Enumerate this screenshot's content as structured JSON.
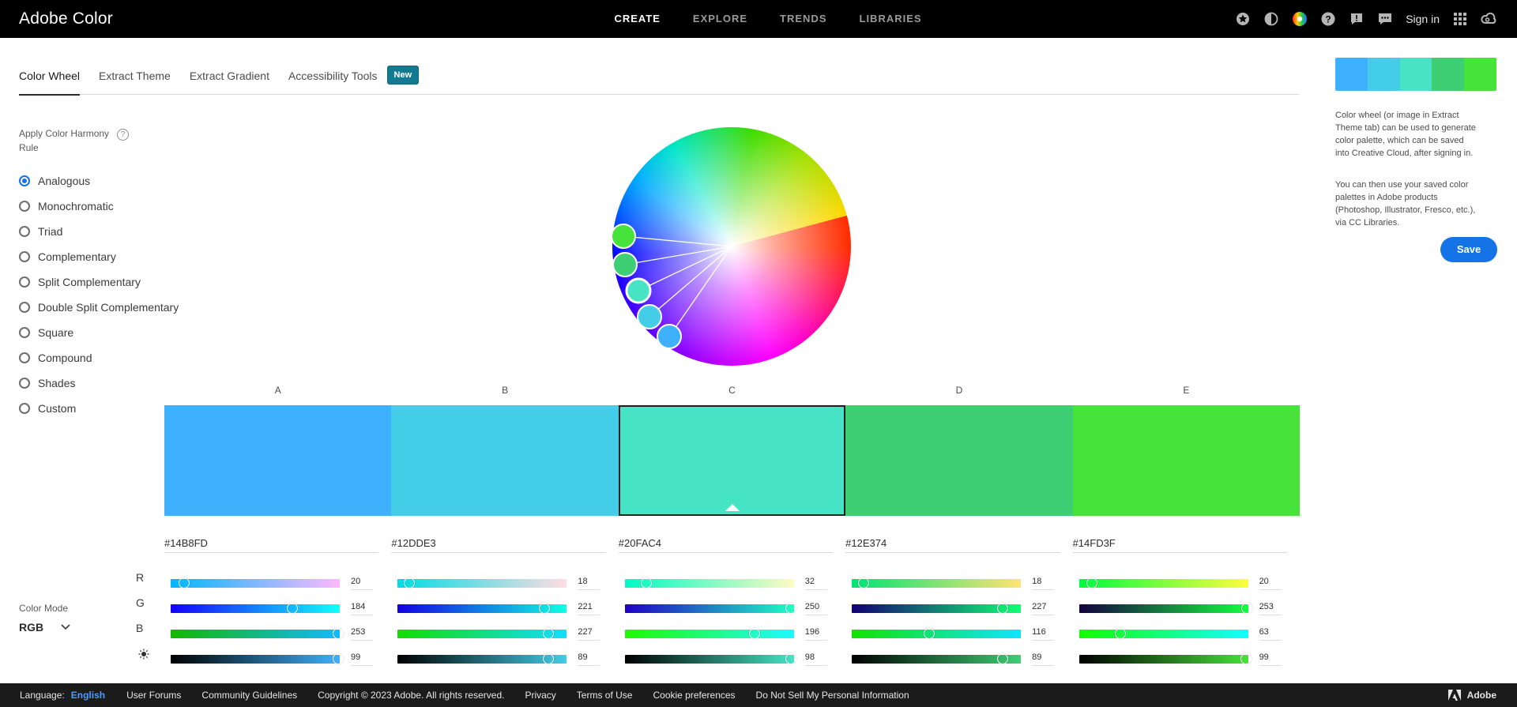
{
  "app": {
    "brand": "Adobe Color"
  },
  "topnav": {
    "items": [
      "CREATE",
      "EXPLORE",
      "TRENDS",
      "LIBRARIES"
    ],
    "active": "CREATE",
    "sign_in": "Sign in",
    "icons": [
      "favorites-icon",
      "contrast-icon",
      "color-wheel-icon",
      "help-icon",
      "feedback-icon",
      "chat-icon",
      "apps-grid-icon",
      "creative-cloud-icon"
    ]
  },
  "tabs": {
    "items": [
      "Color Wheel",
      "Extract Theme",
      "Extract Gradient",
      "Accessibility Tools"
    ],
    "active": "Color Wheel",
    "badge": "New"
  },
  "harmony": {
    "title": "Apply Color Harmony Rule",
    "help": "?",
    "options": [
      "Analogous",
      "Monochromatic",
      "Triad",
      "Complementary",
      "Split Complementary",
      "Double Split Complementary",
      "Square",
      "Compound",
      "Shades",
      "Custom"
    ],
    "selected": "Analogous"
  },
  "color_mode": {
    "label": "Color Mode",
    "value": "RGB"
  },
  "swatches": [
    {
      "label": "A",
      "hex": "#14B8FD",
      "color": "#3fb0fb",
      "r": 20,
      "g": 184,
      "b": 253,
      "brightness": 99
    },
    {
      "label": "B",
      "hex": "#12DDE3",
      "color": "#43cde6",
      "r": 18,
      "g": 221,
      "b": 227,
      "brightness": 89
    },
    {
      "label": "C",
      "hex": "#20FAC4",
      "color": "#46e4c4",
      "r": 32,
      "g": 250,
      "b": 196,
      "brightness": 98
    },
    {
      "label": "D",
      "hex": "#12E374",
      "color": "#3ece74",
      "r": 18,
      "g": 227,
      "b": 116,
      "brightness": 89
    },
    {
      "label": "E",
      "hex": "#14FD3F",
      "color": "#47e23a",
      "r": 20,
      "g": 253,
      "b": 63,
      "brightness": 99
    }
  ],
  "active_swatch": "C",
  "slider_labels": {
    "r": "R",
    "g": "G",
    "b": "B",
    "brightness": "brightness-icon"
  },
  "right_panel": {
    "text1": "Color wheel (or image in Extract Theme tab) can be used to generate color palette, which can be saved into Creative Cloud, after signing in.",
    "text2": "You can then use your saved color palettes in Adobe products (Photoshop, Illustrator, Fresco, etc.), via CC Libraries.",
    "save": "Save"
  },
  "footer": {
    "language_label": "Language:",
    "language": "English",
    "links": [
      "User Forums",
      "Community Guidelines",
      "Copyright © 2023 Adobe. All rights reserved.",
      "Privacy",
      "Terms of Use",
      "Cookie preferences",
      "Do Not Sell My Personal Information"
    ],
    "adobe": "Adobe"
  }
}
